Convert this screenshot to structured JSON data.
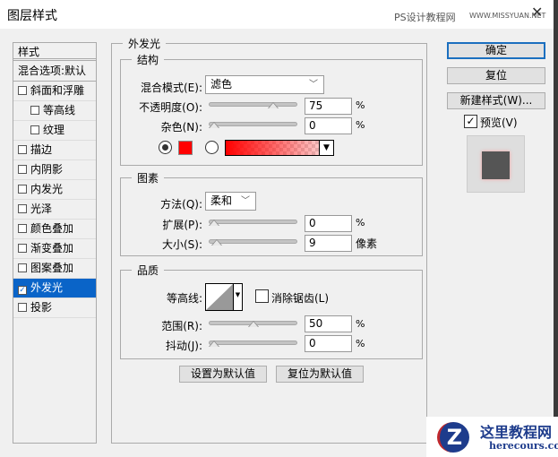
{
  "title": "图层样式",
  "watermark": {
    "site": "PS设计教程网",
    "url": "WWW.MISSYUAN.NET",
    "logo_title": "这里教程网",
    "logo_url": "herecours.com"
  },
  "sidebar": {
    "header": "样式",
    "blend": "混合选项:默认",
    "items": [
      {
        "label": "斜面和浮雕",
        "checked": false
      },
      {
        "label": "等高线",
        "checked": false
      },
      {
        "label": "纹理",
        "checked": false
      },
      {
        "label": "描边",
        "checked": false
      },
      {
        "label": "内阴影",
        "checked": false
      },
      {
        "label": "内发光",
        "checked": false
      },
      {
        "label": "光泽",
        "checked": false
      },
      {
        "label": "颜色叠加",
        "checked": false
      },
      {
        "label": "渐变叠加",
        "checked": false
      },
      {
        "label": "图案叠加",
        "checked": false
      },
      {
        "label": "外发光",
        "checked": true
      },
      {
        "label": "投影",
        "checked": false
      }
    ]
  },
  "panel": {
    "title": "外发光",
    "structure": {
      "title": "结构",
      "blend_label": "混合模式(E):",
      "blend_value": "滤色",
      "opacity_label": "不透明度(O):",
      "opacity": "75",
      "noise_label": "杂色(N):",
      "noise": "0",
      "unit": "%",
      "color": "#ff0000"
    },
    "elements": {
      "title": "图素",
      "method_label": "方法(Q):",
      "method_value": "柔和",
      "spread_label": "扩展(P):",
      "spread": "0",
      "size_label": "大小(S):",
      "size": "9",
      "size_unit": "像素"
    },
    "quality": {
      "title": "品质",
      "contour_label": "等高线:",
      "antialias_label": "消除锯齿(L)",
      "antialias": false,
      "range_label": "范围(R):",
      "range": "50",
      "jitter_label": "抖动(J):",
      "jitter": "0"
    },
    "make_default": "设置为默认值",
    "reset_default": "复位为默认值"
  },
  "buttons": {
    "ok": "确定",
    "reset": "复位",
    "new_style": "新建样式(W)...",
    "preview": "预览(V)",
    "preview_checked": true
  }
}
